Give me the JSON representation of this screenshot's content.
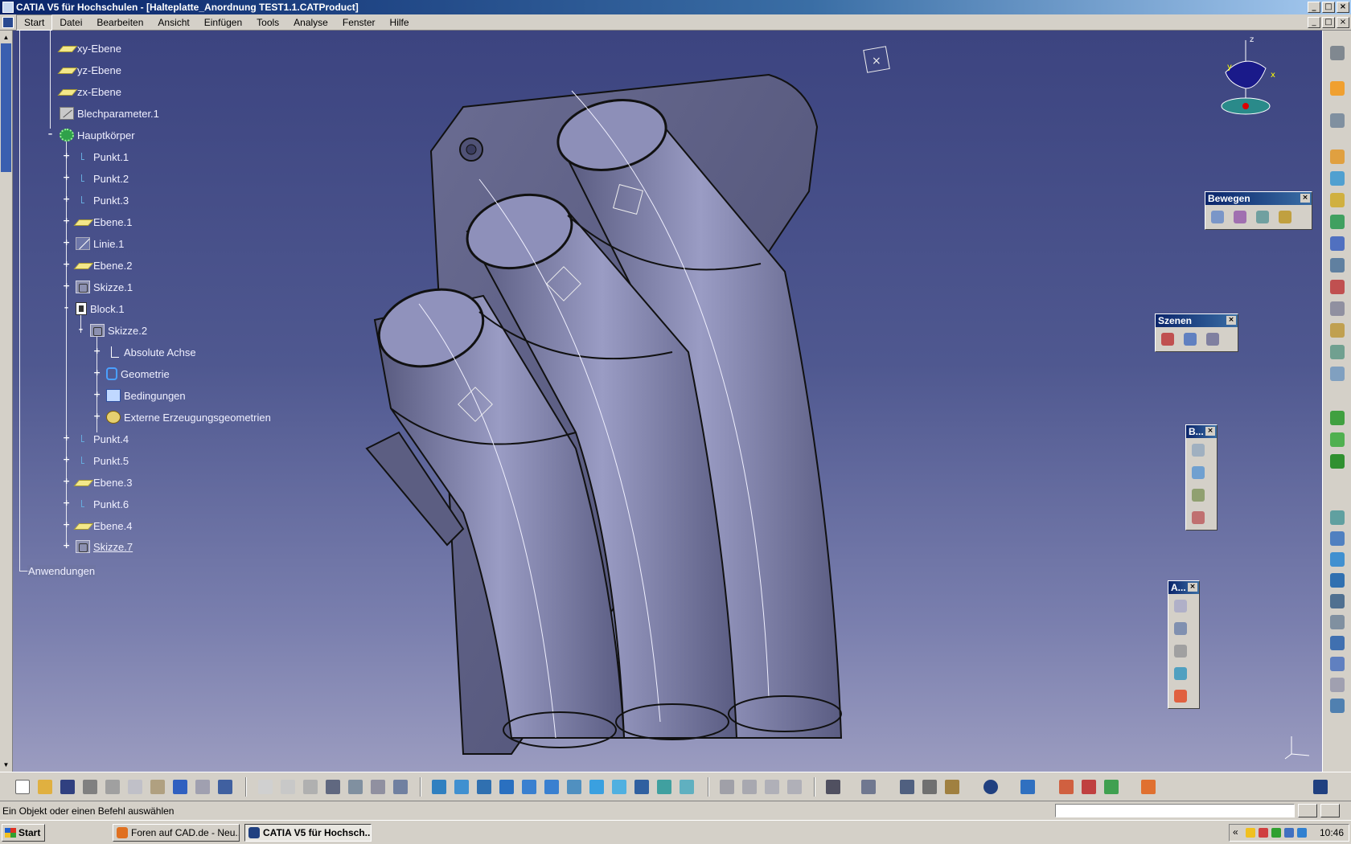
{
  "window": {
    "title": "CATIA V5 für Hochschulen - [Halteplatte_Anordnung TEST1.1.CATProduct]",
    "controls": [
      "_",
      "□",
      "×"
    ]
  },
  "menu": {
    "items": [
      "Start",
      "Datei",
      "Bearbeiten",
      "Ansicht",
      "Einfügen",
      "Tools",
      "Analyse",
      "Fenster",
      "Hilfe"
    ],
    "active": "Start"
  },
  "tree": {
    "nodes": [
      {
        "label": "xy-Ebene",
        "icon": "plane-icon"
      },
      {
        "label": "yz-Ebene",
        "icon": "plane-icon"
      },
      {
        "label": "zx-Ebene",
        "icon": "plane-icon"
      },
      {
        "label": "Blechparameter.1",
        "icon": "sheet-metal-icon"
      },
      {
        "label": "Hauptkörper",
        "icon": "body-gear-icon"
      },
      {
        "label": "Punkt.1",
        "icon": "point-icon"
      },
      {
        "label": "Punkt.2",
        "icon": "point-icon"
      },
      {
        "label": "Punkt.3",
        "icon": "point-icon"
      },
      {
        "label": "Ebene.1",
        "icon": "plane-icon"
      },
      {
        "label": "Linie.1",
        "icon": "line-icon"
      },
      {
        "label": "Ebene.2",
        "icon": "plane-icon"
      },
      {
        "label": "Skizze.1",
        "icon": "sketch-icon"
      },
      {
        "label": "Block.1",
        "icon": "pad-icon"
      },
      {
        "label": "Skizze.2",
        "icon": "sketch-icon"
      },
      {
        "label": "Absolute Achse",
        "icon": "axis-icon"
      },
      {
        "label": "Geometrie",
        "icon": "geometry-icon"
      },
      {
        "label": "Bedingungen",
        "icon": "constraints-icon"
      },
      {
        "label": "Externe Erzeugungsgeometrien",
        "icon": "external-geometry-icon"
      },
      {
        "label": "Punkt.4",
        "icon": "point-icon"
      },
      {
        "label": "Punkt.5",
        "icon": "point-icon"
      },
      {
        "label": "Ebene.3",
        "icon": "plane-icon"
      },
      {
        "label": "Punkt.6",
        "icon": "point-icon"
      },
      {
        "label": "Ebene.4",
        "icon": "plane-icon"
      },
      {
        "label": "Skizze.7",
        "icon": "sketch-icon"
      },
      {
        "label": "Anwendungen",
        "icon": ""
      }
    ]
  },
  "toolbars": {
    "bewegen": {
      "title": "Bewegen",
      "close": "×"
    },
    "szenen": {
      "title": "Szenen",
      "close": "×"
    },
    "b": {
      "title": "B...",
      "close": "×"
    },
    "a": {
      "title": "A...",
      "close": "×"
    }
  },
  "compass": {
    "axes": [
      "z",
      "y",
      "x"
    ]
  },
  "status": {
    "message": "Ein Objekt oder einen Befehl auswählen",
    "command_value": ""
  },
  "taskbar": {
    "start": "Start",
    "tasks": [
      {
        "label": "Foren auf CAD.de - Neu...",
        "active": false
      },
      {
        "label": "CATIA V5 für Hochsch...",
        "active": true
      }
    ],
    "tray_chevron": "«",
    "clock": "10:46"
  },
  "colors": {
    "viewport_top": "#3c4480",
    "viewport_bottom": "#9b9cc0",
    "part": "#6f7196",
    "titlebar": "#0a246a"
  }
}
